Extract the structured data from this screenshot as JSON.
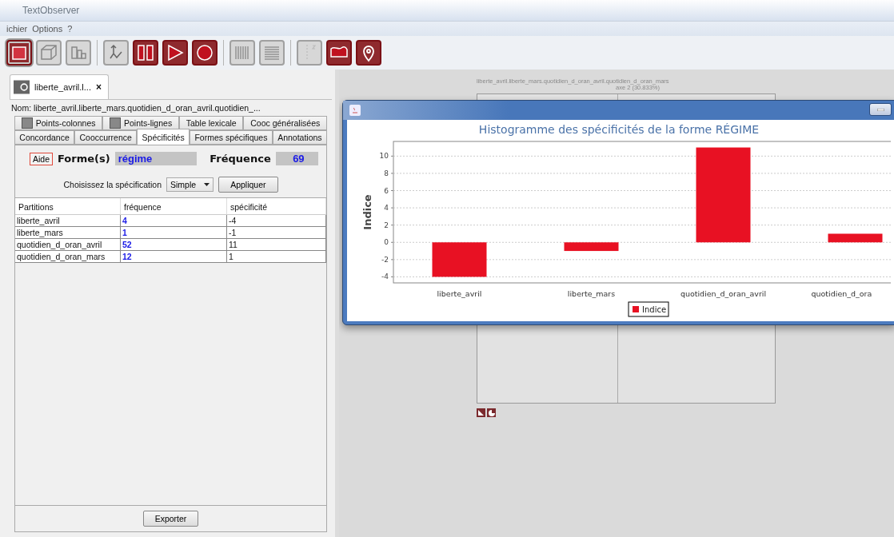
{
  "window": {
    "title": "TextObserver"
  },
  "menu": [
    "ichier",
    "Options",
    "?"
  ],
  "toolbar": [
    [
      {
        "enabled": true,
        "selected": true
      },
      {
        "enabled": false,
        "selected": false
      },
      {
        "enabled": false,
        "selected": false
      }
    ],
    [
      {
        "enabled": false,
        "selected": false
      },
      {
        "enabled": true,
        "selected": false
      },
      {
        "enabled": true,
        "selected": false
      },
      {
        "enabled": true,
        "selected": false
      }
    ],
    [
      {
        "enabled": false,
        "selected": false
      },
      {
        "enabled": false,
        "selected": false
      }
    ],
    [
      {
        "enabled": false,
        "selected": false
      },
      {
        "enabled": true,
        "selected": false
      },
      {
        "enabled": true,
        "selected": false
      }
    ]
  ],
  "document_tab": {
    "label": "liberte_avril.l...",
    "close": "×"
  },
  "name_line": "Nom: liberte_avril.liberte_mars.quotidien_d_oran_avril.quotidien_...",
  "tab_rows": [
    [
      {
        "label": "Points-colonnes",
        "icon": true,
        "selected": false
      },
      {
        "label": "Points-lignes",
        "icon": true,
        "selected": false
      },
      {
        "label": "Table lexicale",
        "icon": false,
        "selected": false
      },
      {
        "label": "Cooc généralisées",
        "icon": false,
        "selected": false
      }
    ],
    [
      {
        "label": "Concordance",
        "icon": false,
        "selected": false
      },
      {
        "label": "Cooccurrence",
        "icon": false,
        "selected": false
      },
      {
        "label": "Spécificités",
        "icon": false,
        "selected": true
      },
      {
        "label": "Formes spécifiques",
        "icon": false,
        "selected": false
      },
      {
        "label": "Annotations",
        "icon": false,
        "selected": false
      }
    ]
  ],
  "form": {
    "help": "Aide",
    "form_label": "Forme(s)",
    "form_value": "régime",
    "freq_label": "Fréquence",
    "freq_value": "69"
  },
  "spec": {
    "label": "Choisissez la spécification",
    "select": "Simple",
    "apply": "Appliquer"
  },
  "table": {
    "columns": [
      "Partitions",
      "fréquence",
      "spécificité"
    ],
    "rows": [
      [
        "liberte_avril",
        "4",
        "-4"
      ],
      [
        "liberte_mars",
        "1",
        "-1"
      ],
      [
        "quotidien_d_oran_avril",
        "52",
        "11"
      ],
      [
        "quotidien_d_oran_mars",
        "12",
        "1"
      ]
    ]
  },
  "export": "Exporter",
  "background_plot": {
    "title": "liberte_avril.liberte_mars.quotidien_d_oran_avril.quotidien_d_oran_mars",
    "axis": "axe 2 (30.833%)"
  },
  "chart_window": {
    "chart_data": {
      "type": "bar",
      "title": "Histogramme des spécificités de la forme RÉGIME",
      "ylabel": "Indice",
      "categories": [
        "liberte_avril",
        "liberte_mars",
        "quotidien_d_oran_avril",
        "quotidien_d_ora"
      ],
      "series": [
        {
          "name": "Indice",
          "color": "#e81123",
          "values": [
            -4,
            -1,
            11,
            1
          ]
        }
      ],
      "grid": true,
      "ylim": [
        -4.7,
        11.7
      ],
      "yticks": [
        -4,
        -2,
        0,
        2,
        4,
        6,
        8,
        10
      ]
    }
  }
}
